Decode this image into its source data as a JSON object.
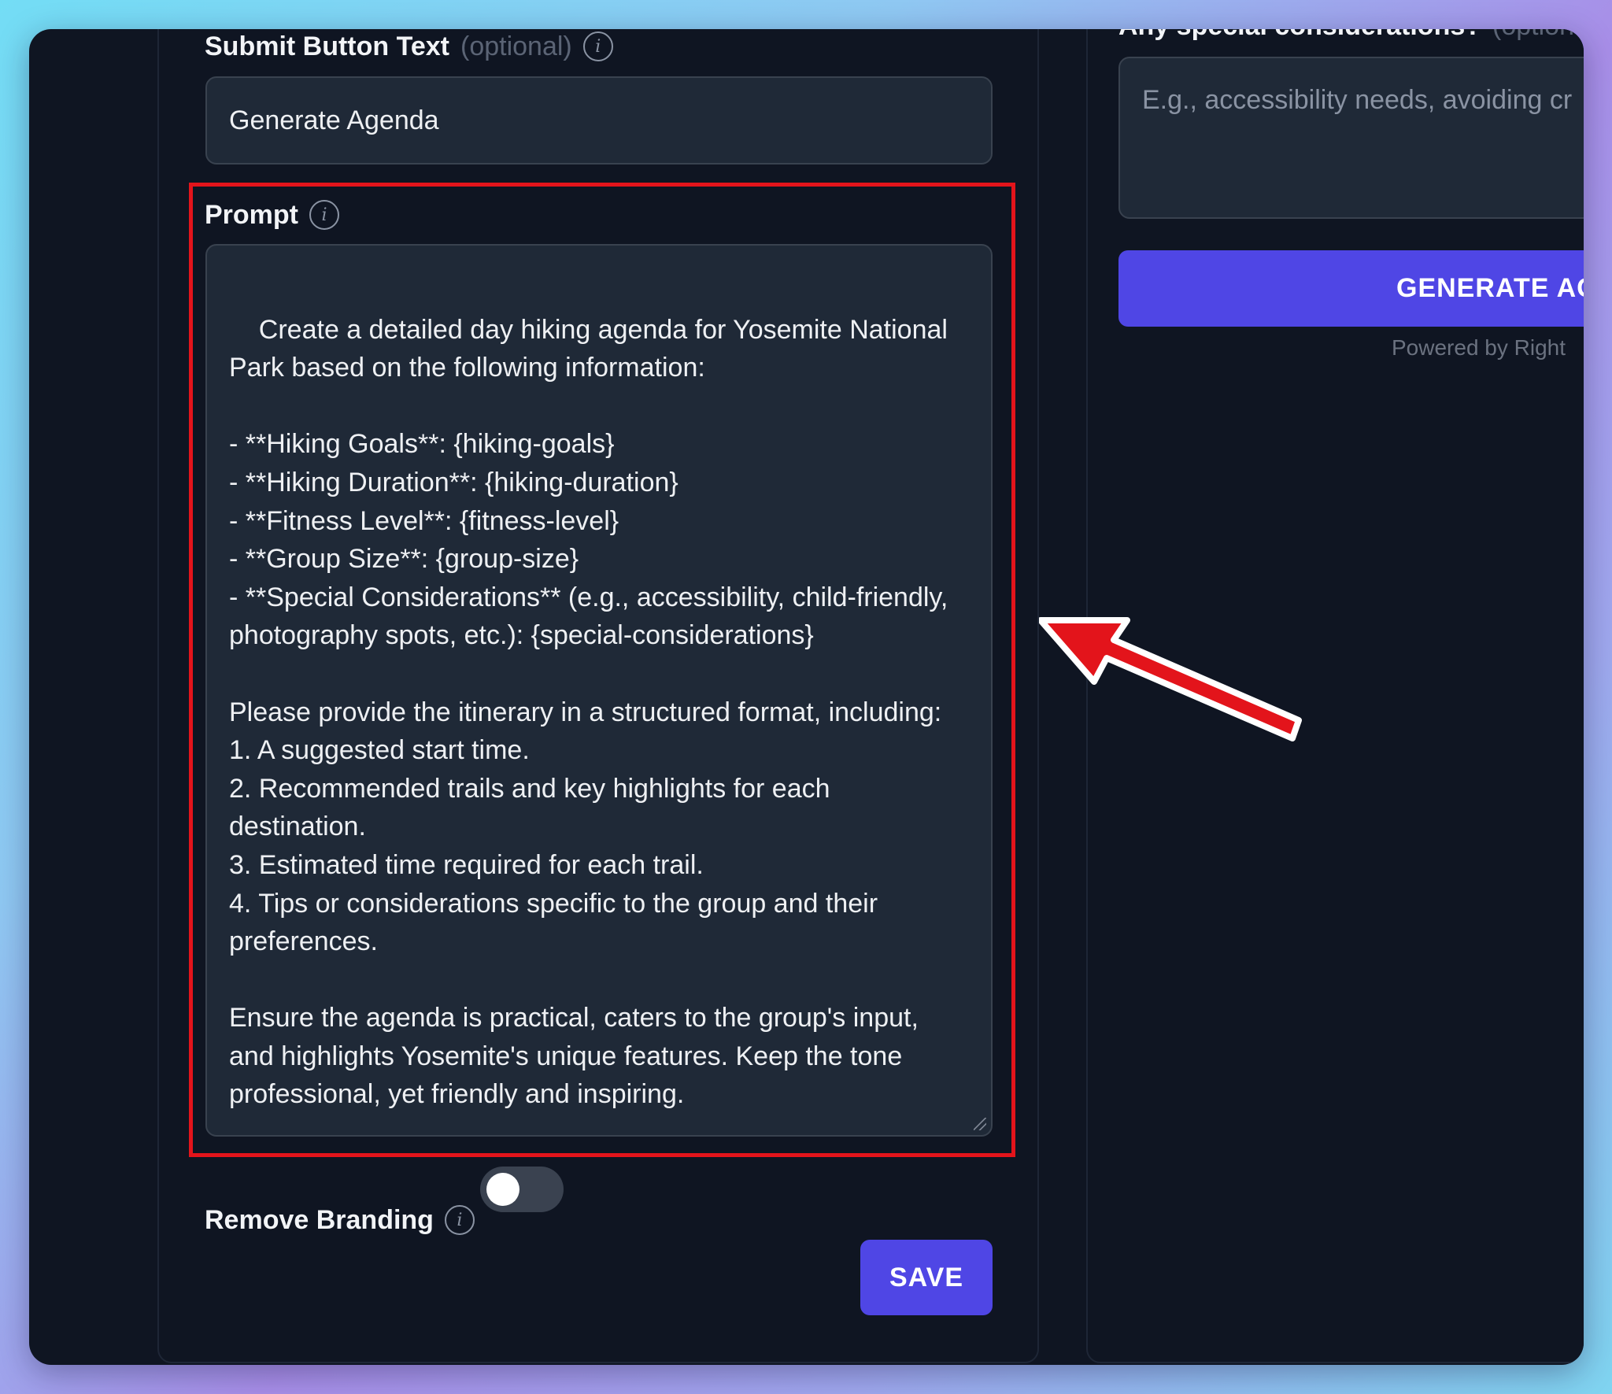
{
  "submit_field": {
    "label": "Submit Button Text",
    "optional": "(optional)",
    "value": "Generate Agenda"
  },
  "prompt_field": {
    "label": "Prompt",
    "value": "Create a detailed day hiking agenda for Yosemite National Park based on the following information:\n\n- **Hiking Goals**: {hiking-goals}\n- **Hiking Duration**: {hiking-duration}\n- **Fitness Level**: {fitness-level}\n- **Group Size**: {group-size}\n- **Special Considerations** (e.g., accessibility, child-friendly, photography spots, etc.): {special-considerations}\n\nPlease provide the itinerary in a structured format, including:\n1. A suggested start time.\n2. Recommended trails and key highlights for each destination.\n3. Estimated time required for each trail.\n4. Tips or considerations specific to the group and their preferences.\n\nEnsure the agenda is practical, caters to the group's input, and highlights Yosemite's unique features. Keep the tone professional, yet friendly and inspiring."
  },
  "branding": {
    "label": "Remove Branding",
    "toggle_on": false
  },
  "save_label": "SAVE",
  "preview": {
    "special_label": "Any special considerations?",
    "special_optional": "(optional)",
    "special_placeholder": "E.g., accessibility needs, avoiding cr",
    "generate_label": "GENERATE AG",
    "powered_by": "Powered by Right"
  },
  "colors": {
    "accent": "#4f46e5",
    "highlight": "#e3141b",
    "panel_bg": "#0f1522",
    "field_bg": "#1f2937"
  },
  "icons": [
    "info-icon",
    "red-arrow-annotation"
  ]
}
